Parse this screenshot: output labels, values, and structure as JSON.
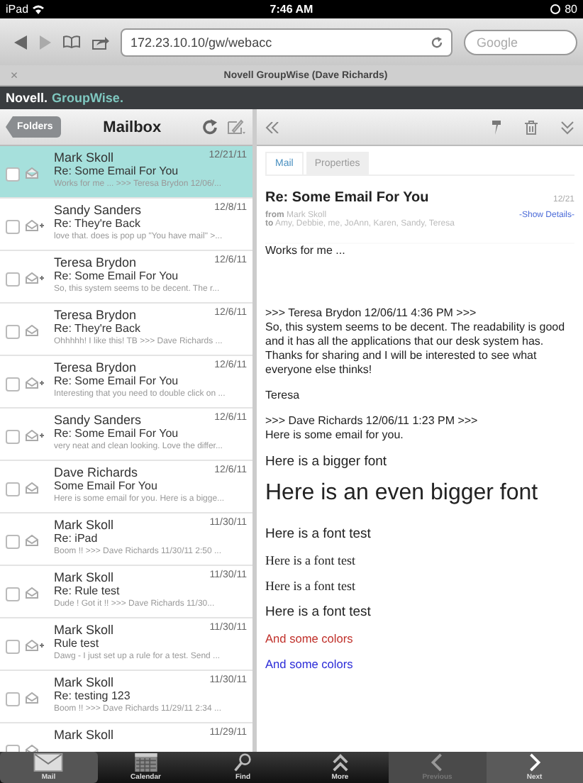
{
  "status_bar": {
    "device": "iPad",
    "time": "7:46 AM",
    "battery": "80"
  },
  "browser": {
    "url": "172.23.10.10/gw/webacc",
    "search_placeholder": "Google",
    "tab_close": "×",
    "tab_title": "Novell GroupWise (Dave Richards)"
  },
  "app_header": {
    "brand": "Novell.",
    "product": "GroupWise."
  },
  "list_toolbar": {
    "back_button": "Folders",
    "title": "Mailbox"
  },
  "messages": [
    {
      "from": "Mark Skoll",
      "date": "12/21/11",
      "subject": "Re: Some Email For You",
      "preview": "Works for me ... >>> Teresa Brydon 12/06/...",
      "selected": true,
      "replied": false
    },
    {
      "from": "Sandy Sanders",
      "date": "12/8/11",
      "subject": "Re: They're Back",
      "preview": "love that. does is pop up \"You have mail\" >...",
      "selected": false,
      "replied": true
    },
    {
      "from": "Teresa Brydon",
      "date": "12/6/11",
      "subject": "Re: Some Email For You",
      "preview": "So, this system seems to be decent.  The r...",
      "selected": false,
      "replied": true
    },
    {
      "from": "Teresa Brydon",
      "date": "12/6/11",
      "subject": "Re: They're Back",
      "preview": "Ohhhhh!  I like this! TB >>> Dave Richards ...",
      "selected": false,
      "replied": false
    },
    {
      "from": "Teresa Brydon",
      "date": "12/6/11",
      "subject": "Re: Some Email For You",
      "preview": "Interesting that you need to double click on ...",
      "selected": false,
      "replied": true
    },
    {
      "from": "Sandy Sanders",
      "date": "12/6/11",
      "subject": "Re: Some Email For You",
      "preview": "very neat and clean looking. Love the differ...",
      "selected": false,
      "replied": true
    },
    {
      "from": "Dave Richards",
      "date": "12/6/11",
      "subject": "Some Email For You",
      "preview": "Here is some email for you. Here is a bigge...",
      "selected": false,
      "replied": false
    },
    {
      "from": "Mark Skoll",
      "date": "11/30/11",
      "subject": "Re: iPad",
      "preview": "Boom !! >>> Dave Richards 11/30/11 2:50 ...",
      "selected": false,
      "replied": false
    },
    {
      "from": "Mark Skoll",
      "date": "11/30/11",
      "subject": "Re: Rule test",
      "preview": "Dude !    Got it !! >>> Dave Richards 11/30...",
      "selected": false,
      "replied": false
    },
    {
      "from": "Mark Skoll",
      "date": "11/30/11",
      "subject": "Rule test",
      "preview": "Dawg - I just set up a rule for a test.  Send ...",
      "selected": false,
      "replied": true
    },
    {
      "from": "Mark Skoll",
      "date": "11/30/11",
      "subject": "Re: testing 123",
      "preview": "Boom !! >>> Dave Richards 11/29/11 2:34 ...",
      "selected": false,
      "replied": false
    },
    {
      "from": "Mark Skoll",
      "date": "11/29/11",
      "selected": false,
      "replied": false
    }
  ],
  "reader": {
    "tabs": [
      {
        "label": "Mail",
        "selected": true
      },
      {
        "label": "Properties",
        "selected": false
      }
    ],
    "subject": "Re: Some Email For You",
    "date": "12/21",
    "from_label": "from",
    "from": "Mark Skoll",
    "to_label": "to",
    "to": "Amy, Debbie, me, JoAnn, Karen, Sandy, Teresa",
    "show_details": "-Show Details-",
    "body": [
      {
        "kind": "normal",
        "text": "Works for me ..."
      },
      {
        "kind": "spacer"
      },
      {
        "kind": "normal",
        "text": ">>> Teresa Brydon 12/06/11 4:36 PM >>>\nSo, this system seems to be decent.  The readability is good and it has all the applications that our desk system has.  Thanks for sharing and I will be interested to see what everyone else thinks!"
      },
      {
        "kind": "normal",
        "text": "Teresa"
      },
      {
        "kind": "normal",
        "text": ">>> Dave Richards 12/06/11 1:23 PM >>>\nHere is some email for you."
      },
      {
        "kind": "big",
        "text": "Here is a bigger font"
      },
      {
        "kind": "huge",
        "text": "Here is an even bigger font"
      },
      {
        "kind": "big",
        "text": "Here is a font test"
      },
      {
        "kind": "serif",
        "text": "Here is a font test"
      },
      {
        "kind": "serif",
        "text": "Here is a font test"
      },
      {
        "kind": "big",
        "text": "Here is a font test"
      },
      {
        "kind": "colored",
        "text": "And some colors",
        "color": "#c0302a"
      },
      {
        "kind": "colored",
        "text": "And some colors",
        "color": "#2b2bd8"
      }
    ]
  },
  "bottom_tabs": [
    {
      "kind": "mail",
      "label": "Mail",
      "selected": true,
      "disabled": false
    },
    {
      "kind": "calendar",
      "label": "Calendar",
      "selected": false,
      "disabled": false
    },
    {
      "kind": "find",
      "label": "Find",
      "selected": false,
      "disabled": false
    },
    {
      "kind": "more",
      "label": "More",
      "selected": false,
      "disabled": false
    },
    {
      "kind": "previous",
      "label": "Previous",
      "selected": false,
      "disabled": true
    },
    {
      "kind": "next",
      "label": "Next",
      "selected": false,
      "disabled": false
    }
  ]
}
